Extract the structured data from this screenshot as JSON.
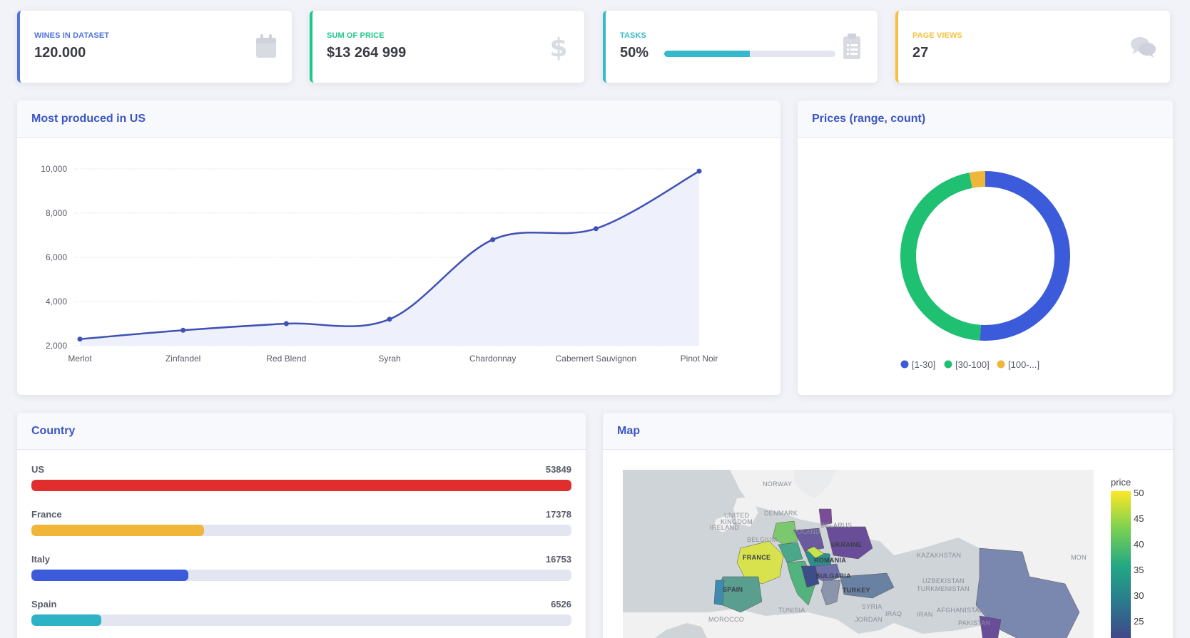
{
  "kpis": [
    {
      "label": "Wines in dataset",
      "value": "120.000",
      "icon": "calendar-icon",
      "color": "#4e73df"
    },
    {
      "label": "Sum of price",
      "value": "$13 264 999",
      "icon": "dollar-icon",
      "color": "#1cc88a"
    },
    {
      "label": "Tasks",
      "value": "50%",
      "icon": "clipboard-icon",
      "color": "#36b9cc",
      "progress": 0.5
    },
    {
      "label": "Page views",
      "value": "27",
      "icon": "comments-icon",
      "color": "#f6c23e"
    }
  ],
  "line_card": {
    "title": "Most produced in US"
  },
  "donut_card": {
    "title": "Prices (range, count)"
  },
  "country_card": {
    "title": "Country",
    "rows": [
      {
        "name": "US",
        "count": "53849",
        "fraction": 1.0,
        "color": "#e02e2e"
      },
      {
        "name": "France",
        "count": "17378",
        "fraction": 0.32,
        "color": "#f0b63a"
      },
      {
        "name": "Italy",
        "count": "16753",
        "fraction": 0.29,
        "color": "#3b5bdb"
      },
      {
        "name": "Spain",
        "count": "6526",
        "fraction": 0.13,
        "color": "#2eb2c5"
      }
    ]
  },
  "map_card": {
    "title": "Map",
    "colorbar_title": "price",
    "colorbar_ticks": [
      "50",
      "45",
      "40",
      "35",
      "30",
      "25"
    ],
    "labels": [
      "NORWAY",
      "DENMARK",
      "UNITED KINGDOM",
      "IRELAND",
      "BELGIUM",
      "POLAND",
      "BELARUS",
      "UKRAINE",
      "FRANCE",
      "ROMANIA",
      "BULGARIA",
      "SPAIN",
      "TURKEY",
      "KAZAKHSTAN",
      "UZBEKISTAN",
      "TURKMENISTAN",
      "TUNISIA",
      "SYRIA",
      "IRAQ",
      "IRAN",
      "AFGHANISTAN",
      "PAKISTAN",
      "MOROCCO",
      "JORDAN",
      "MON"
    ]
  },
  "chart_data": [
    {
      "type": "line",
      "title": "Most produced in US",
      "categories": [
        "Merlot",
        "Zinfandel",
        "Red Blend",
        "Syrah",
        "Chardonnay",
        "Cabernert Sauvignon",
        "Pinot Noir"
      ],
      "values": [
        2300,
        2700,
        3000,
        3200,
        6800,
        7300,
        9900
      ],
      "ylim": [
        2000,
        10000
      ],
      "yticks": [
        "10,000",
        "8,000",
        "6,000",
        "4,000",
        "2,000"
      ],
      "grid": true,
      "color": "#3f51b5"
    },
    {
      "type": "pie",
      "title": "Prices (range, count)",
      "labels": [
        "[1-30]",
        "[30-100]",
        "[100-...]"
      ],
      "values": [
        51,
        46,
        3
      ],
      "colors": [
        "#3b5bdb",
        "#1fc071",
        "#f0b63a"
      ],
      "legend": "bottom"
    }
  ]
}
